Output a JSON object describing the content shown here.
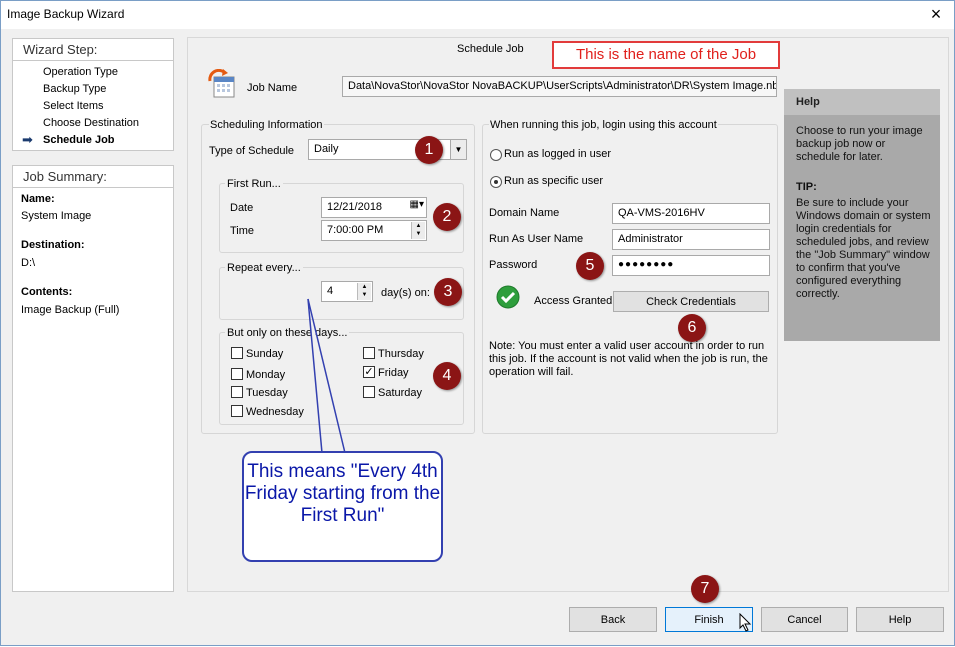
{
  "window": {
    "title": "Image Backup Wizard",
    "close_glyph": "×"
  },
  "wizard": {
    "heading": "Wizard Step:",
    "steps": [
      {
        "label": "Operation Type"
      },
      {
        "label": "Backup Type"
      },
      {
        "label": "Select Items"
      },
      {
        "label": "Choose Destination"
      },
      {
        "label": "Schedule Job"
      }
    ],
    "active_arrow": "➡"
  },
  "summary": {
    "heading": "Job Summary:",
    "name_label": "Name:",
    "name_value": "System Image",
    "dest_label": "Destination:",
    "dest_value": "D:\\",
    "contents_label": "Contents:",
    "contents_value": "Image Backup (Full)"
  },
  "page": {
    "title": "Schedule Job"
  },
  "callout_top": "This is the name of the Job",
  "job": {
    "name_label": "Job Name",
    "name_value": "Data\\NovaStor\\NovaStor NovaBACKUP\\UserScripts\\Administrator\\DR\\System Image.nbk"
  },
  "scheduling": {
    "group_label": "Scheduling Information",
    "type_label": "Type of Schedule",
    "type_value": "Daily",
    "first_run_label": "First Run...",
    "date_label": "Date",
    "date_value": "12/21/2018",
    "time_label": "Time",
    "time_value": "7:00:00 PM",
    "repeat_label": "Repeat every...",
    "repeat_value": "4",
    "repeat_suffix": "day(s) on:",
    "days_label": "But only on these days...",
    "days": [
      {
        "label": "Sunday",
        "checked": false
      },
      {
        "label": "Monday",
        "checked": false
      },
      {
        "label": "Tuesday",
        "checked": false
      },
      {
        "label": "Wednesday",
        "checked": false
      },
      {
        "label": "Thursday",
        "checked": false
      },
      {
        "label": "Friday",
        "checked": true
      },
      {
        "label": "Saturday",
        "checked": false
      }
    ]
  },
  "login": {
    "group_label": "When running this job, login using this account",
    "radio_logged_in": "Run as logged in user",
    "radio_specific": "Run as specific user",
    "domain_label": "Domain Name",
    "domain_value": "QA-VMS-2016HV",
    "user_label": "Run As User Name",
    "user_value": "Administrator",
    "password_label": "Password",
    "password_value": "●●●●●●●●",
    "access_label": "Access Granted",
    "check_button": "Check Credentials",
    "note": "Note: You must enter a valid user account in order to run this job. If the account is not valid when the job is run, the operation will fail."
  },
  "help": {
    "heading": "Help",
    "text1": "Choose to run your image backup job now or schedule for later.",
    "tip_label": "TIP:",
    "text2": "Be sure to include your Windows domain or system login credentials for scheduled jobs, and review the \"Job Summary\" window to confirm that you've configured everything correctly."
  },
  "bubble": "This means \"Every 4th Friday starting from the First Run\"",
  "badges": [
    "1",
    "2",
    "3",
    "4",
    "5",
    "6",
    "7"
  ],
  "buttons": {
    "back": "Back",
    "finish": "Finish",
    "cancel": "Cancel",
    "help": "Help"
  },
  "colors": {
    "badge": "#8b1515",
    "callout_red": "#e0201c",
    "bubble_blue": "#0a17a8",
    "help_bg": "#a9a9a9"
  }
}
